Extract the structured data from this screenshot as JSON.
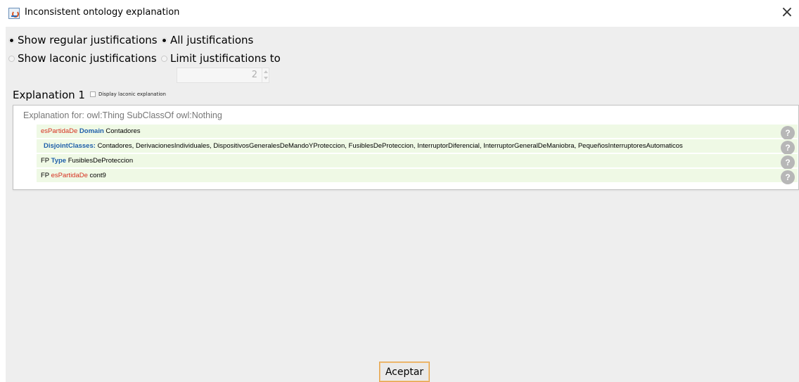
{
  "window": {
    "title": "Inconsistent ontology explanation",
    "close_glyph": "×",
    "icon": "java-coffee-icon"
  },
  "options": {
    "show_regular": {
      "label": "Show regular justifications",
      "selected": true
    },
    "show_laconic": {
      "label": "Show laconic justifications",
      "selected": false
    },
    "all_justifications": {
      "label": "All justifications",
      "selected": true
    },
    "limit_justifications": {
      "label": "Limit justifications to",
      "selected": false
    },
    "limit_value": "2"
  },
  "explanation": {
    "heading": "Explanation 1",
    "laconic_checkbox_label": "Display laconic explanation",
    "laconic_checked": false,
    "header": "Explanation for: owl:Thing SubClassOf owl:Nothing",
    "axioms": [
      {
        "a": "esPartidaDe",
        "b": "Domain",
        "c": "Contadores"
      },
      {
        "a": "",
        "b": "DisjointClasses:",
        "c": "Contadores, DerivacionesIndividuales, DispositivosGeneralesDeMandoYProteccion, FusiblesDeProteccion, InterruptorDiferencial, InterruptorGeneralDeManiobra, PequeñosInterruptoresAutomaticos"
      },
      {
        "a": "FP",
        "b": "Type",
        "c": "FusiblesDeProteccion"
      },
      {
        "a": "FP",
        "b": "esPartidaDe",
        "c": "cont9"
      }
    ],
    "help_glyph": "?"
  },
  "footer": {
    "ok_label": "Aceptar"
  },
  "colors": {
    "row_background": "#eff9e5",
    "keyword_blue": "#1f5faa",
    "property_red": "#d6301f",
    "focus_border": "#e3a34a"
  }
}
